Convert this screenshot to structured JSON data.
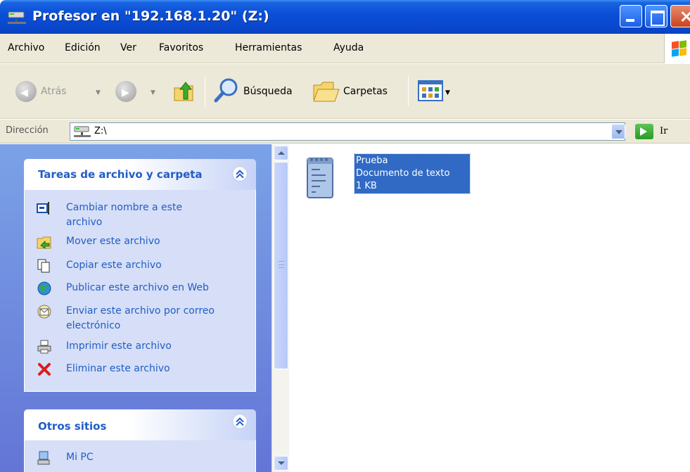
{
  "window": {
    "title": "Profesor en \"192.168.1.20\" (Z:)"
  },
  "menu": {
    "items": [
      "Archivo",
      "Edición",
      "Ver",
      "Favoritos",
      "Herramientas",
      "Ayuda"
    ]
  },
  "toolbar": {
    "back_label": "Atrás",
    "search_label": "Búsqueda",
    "folders_label": "Carpetas"
  },
  "address": {
    "label": "Dirección",
    "value": "Z:\\",
    "go_label": "Ir"
  },
  "tasks_panel": {
    "title": "Tareas de archivo y carpeta",
    "items": [
      {
        "label": "Cambiar nombre a este archivo",
        "icon": "rename-icon"
      },
      {
        "label": "Mover este archivo",
        "icon": "move-icon"
      },
      {
        "label": "Copiar este archivo",
        "icon": "copy-icon"
      },
      {
        "label": "Publicar este archivo en Web",
        "icon": "publish-web-icon"
      },
      {
        "label": "Enviar este archivo por correo electrónico",
        "icon": "email-icon"
      },
      {
        "label": "Imprimir este archivo",
        "icon": "print-icon"
      },
      {
        "label": "Eliminar este archivo",
        "icon": "delete-icon"
      }
    ]
  },
  "places_panel": {
    "title": "Otros sitios",
    "items": [
      {
        "label": "Mi PC",
        "icon": "my-computer-icon"
      }
    ]
  },
  "files": [
    {
      "name": "Prueba",
      "type": "Documento de texto",
      "size": "1 KB",
      "selected": true
    }
  ],
  "colors": {
    "titlebar": "#0b4fd8",
    "task_link": "#215dc6",
    "selection": "#316ac5",
    "left_pane": "#7ba2e7"
  }
}
